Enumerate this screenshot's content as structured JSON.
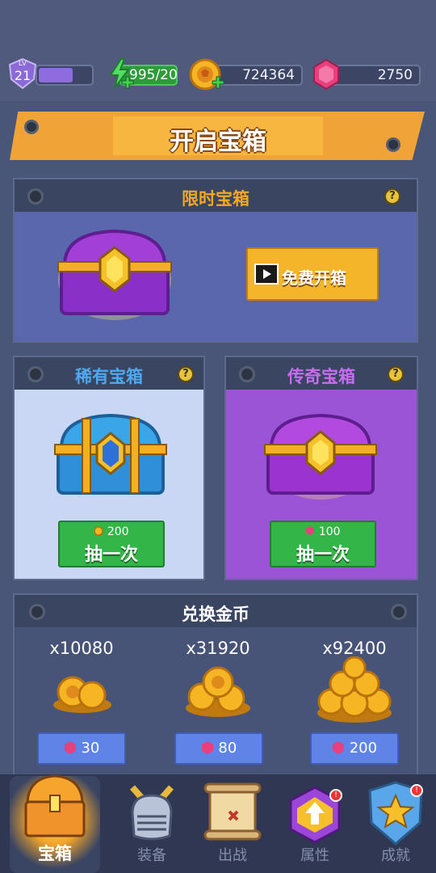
{
  "status": {
    "level_prefix": "LV",
    "level": "21",
    "xp_fraction": 0.62,
    "energy": "995/20",
    "coins": "724364",
    "gems": "2750"
  },
  "banner": {
    "title": "开启宝箱"
  },
  "limited": {
    "title": "限时宝箱",
    "button": "免费开箱"
  },
  "rare": {
    "title": "稀有宝箱",
    "cost": "200",
    "button": "抽一次"
  },
  "legend": {
    "title": "传奇宝箱",
    "cost": "100",
    "button": "抽一次"
  },
  "exchange": {
    "title": "兑换金币",
    "offers": [
      {
        "amount": "x10080",
        "price": "30"
      },
      {
        "amount": "x31920",
        "price": "80"
      },
      {
        "amount": "x92400",
        "price": "200"
      }
    ]
  },
  "nav": [
    {
      "label": "宝箱",
      "icon": "treasure-chest-icon",
      "selected": true
    },
    {
      "label": "装备",
      "icon": "helmet-icon"
    },
    {
      "label": "出战",
      "icon": "map-scroll-icon"
    },
    {
      "label": "属性",
      "icon": "upgrade-arrow-icon"
    },
    {
      "label": "成就",
      "icon": "star-shield-icon"
    }
  ],
  "help_glyph": "?",
  "colors": {
    "accent_orange": "#f5b52b",
    "rare_blue": "#c9d6f4",
    "legend_purple": "#9b54d6",
    "green": "#34b548",
    "gem_pink": "#e8407f"
  }
}
